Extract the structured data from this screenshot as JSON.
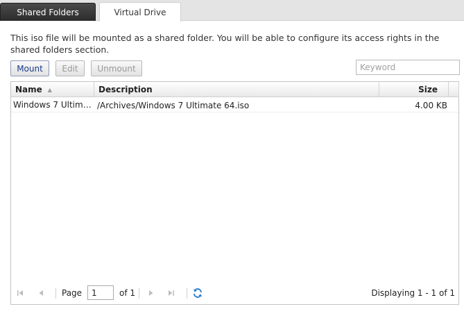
{
  "tabs": [
    {
      "label": "Shared Folders",
      "active": false
    },
    {
      "label": "Virtual Drive",
      "active": true
    }
  ],
  "description": "This iso file will be mounted as a shared folder. You will be able to configure its access rights in the shared folders section.",
  "toolbar": {
    "mount_label": "Mount",
    "edit_label": "Edit",
    "unmount_label": "Unmount",
    "search_placeholder": "Keyword"
  },
  "grid": {
    "columns": {
      "name": "Name",
      "description": "Description",
      "size": "Size"
    },
    "rows": [
      {
        "name": "Windows 7 Ultimat…",
        "description": "/Archives/Windows 7 Ultimate 64.iso",
        "size": "4.00 KB"
      }
    ]
  },
  "paging": {
    "page_label": "Page",
    "page_value": "1",
    "of_label": "of 1",
    "display": "Displaying 1 - 1 of 1"
  },
  "colors": {
    "accent": "#1a3a8a",
    "tab_dark": "#2c2c2c",
    "refresh_icon": "#2a7fd4"
  }
}
